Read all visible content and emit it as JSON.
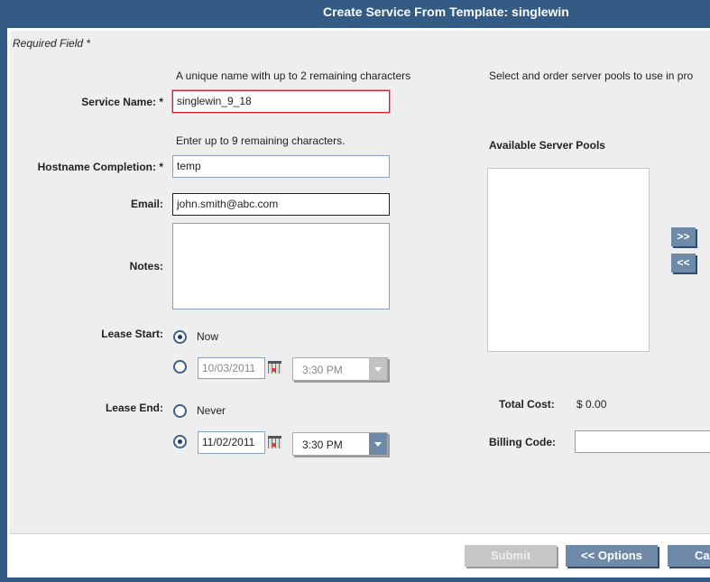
{
  "title": "Create Service From Template: singlewin",
  "required_note": "Required Field *",
  "service_name": {
    "hint": "A unique name with up to 2 remaining characters",
    "label": "Service Name:",
    "req": "*",
    "value": "singlewin_9_18"
  },
  "hostname": {
    "hint": "Enter up to 9 remaining characters.",
    "label": "Hostname Completion:",
    "req": "*",
    "value": "temp"
  },
  "email": {
    "label": "Email:",
    "value": "john.smith@abc.com"
  },
  "notes": {
    "label": "Notes:",
    "value": ""
  },
  "lease_start": {
    "label": "Lease Start:",
    "now_label": "Now",
    "now_selected": true,
    "date": "10/03/2011",
    "time": "3:30 PM"
  },
  "lease_end": {
    "label": "Lease End:",
    "never_label": "Never",
    "never_selected": false,
    "date": "11/02/2011",
    "time": "3:30 PM"
  },
  "pools": {
    "hint": "Select and order server pools to use in pro",
    "available_label": "Available Server Pools",
    "add": ">>",
    "remove": "<<"
  },
  "total_cost": {
    "label": "Total Cost:",
    "value": "$ 0.00"
  },
  "billing_code": {
    "label": "Billing Code:",
    "value": ""
  },
  "buttons": {
    "submit": "Submit",
    "options": "<< Options",
    "cancel": "Ca"
  },
  "colors": {
    "header": "#335b84",
    "button": "#6e8aa8",
    "error_border": "#cc2233"
  }
}
